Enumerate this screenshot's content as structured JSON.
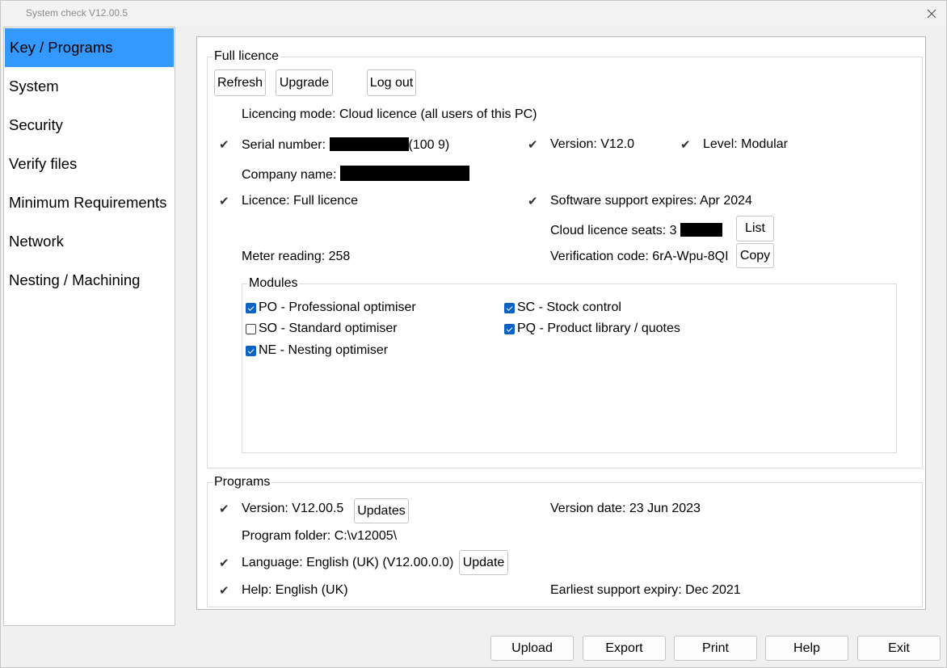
{
  "window": {
    "title": "System check V12.00.5"
  },
  "sidebar": {
    "items": [
      {
        "label": "Key / Programs"
      },
      {
        "label": "System"
      },
      {
        "label": "Security"
      },
      {
        "label": "Verify files"
      },
      {
        "label": "Minimum Requirements"
      },
      {
        "label": "Network"
      },
      {
        "label": "Nesting / Machining"
      }
    ]
  },
  "licence": {
    "legend": "Full licence",
    "refresh": "Refresh",
    "upgrade": "Upgrade",
    "logout": "Log out",
    "mode": "Licencing mode: Cloud licence (all users of this PC)",
    "serial_label": "Serial number:",
    "serial_suffix": "(100 9)",
    "version": "Version: V12.0",
    "level": "Level: Modular",
    "company_label": "Company name:",
    "licence": "Licence: Full licence",
    "support": "Software support expires: Apr 2024",
    "seats": "Cloud licence seats: 3",
    "list": "List",
    "meter": "Meter reading: 258",
    "verification": "Verification code: 6rA-Wpu-8QI",
    "copy": "Copy"
  },
  "modules": {
    "legend": "Modules",
    "items": [
      {
        "label": "PO - Professional optimiser",
        "checked": true
      },
      {
        "label": "SO - Standard optimiser",
        "checked": false
      },
      {
        "label": "NE - Nesting optimiser",
        "checked": true
      },
      {
        "label": "SC - Stock control",
        "checked": true
      },
      {
        "label": "PQ - Product library / quotes",
        "checked": true
      }
    ]
  },
  "programs": {
    "legend": "Programs",
    "version": "Version: V12.00.5",
    "updates": "Updates",
    "version_date": "Version date: 23 Jun 2023",
    "folder": "Program folder: C:\\v12005\\",
    "language": "Language: English (UK) (V12.00.0.0)",
    "update": "Update",
    "help": "Help: English (UK)",
    "earliest": "Earliest support expiry: Dec 2021"
  },
  "footer": {
    "upload": "Upload",
    "export": "Export",
    "print": "Print",
    "help": "Help",
    "exit": "Exit"
  },
  "icons": {
    "check": "checkmark-icon",
    "close": "close-icon"
  },
  "colors": {
    "accent": "#3399ff",
    "checkbox": "#0a62c2"
  }
}
